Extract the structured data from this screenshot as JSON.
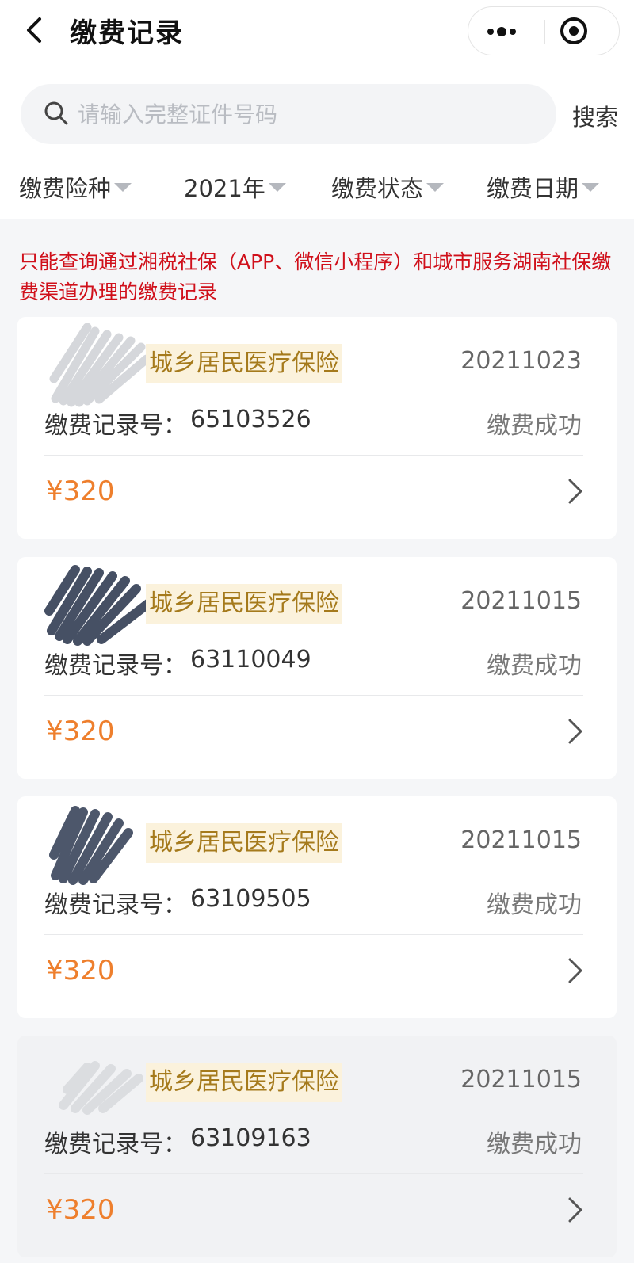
{
  "header": {
    "title": "缴费记录",
    "back_icon": "back-arrow-icon",
    "more_icon": "more-dots-icon",
    "close_icon": "miniprogram-close-icon"
  },
  "search": {
    "placeholder": "请输入完整证件号码",
    "value": "",
    "button_label": "搜索"
  },
  "filters": [
    {
      "label": "缴费险种"
    },
    {
      "label": "2021年"
    },
    {
      "label": "缴费状态"
    },
    {
      "label": "缴费日期"
    }
  ],
  "notice": "只能查询通过湘税社保（APP、微信小程序）和城市服务湖南社保缴费渠道办理的缴费记录",
  "record_label": "缴费记录号：",
  "records": [
    {
      "insurance": "城乡居民医疗保险",
      "date": "20211023",
      "record_no": "65103526",
      "status": "缴费成功",
      "amount": "¥320"
    },
    {
      "insurance": "城乡居民医疗保险",
      "date": "20211015",
      "record_no": "63110049",
      "status": "缴费成功",
      "amount": "¥320"
    },
    {
      "insurance": "城乡居民医疗保险",
      "date": "20211015",
      "record_no": "63109505",
      "status": "缴费成功",
      "amount": "¥320"
    },
    {
      "insurance": "城乡居民医疗保险",
      "date": "20211015",
      "record_no": "63109163",
      "status": "缴费成功",
      "amount": "¥320"
    }
  ],
  "colors": {
    "notice": "#d0101b",
    "amount": "#ee7f2d",
    "insurance_text": "#a57a1c",
    "insurance_bg": "#fbf2dc"
  }
}
